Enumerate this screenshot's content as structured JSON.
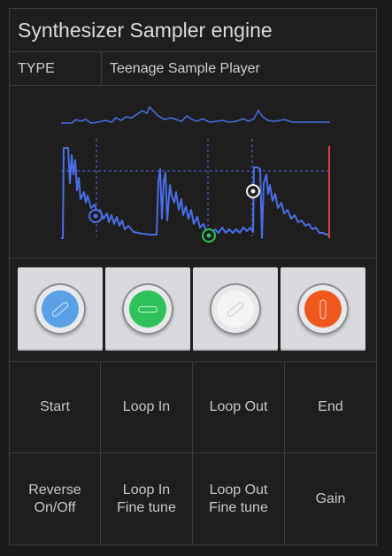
{
  "title": "Synthesizer Sampler engine",
  "type_row": {
    "label": "TYPE",
    "value": "Teenage Sample Player"
  },
  "knobs": [
    {
      "name": "blue",
      "color": "#5aa0e6"
    },
    {
      "name": "green",
      "color": "#2ec35a"
    },
    {
      "name": "white",
      "color": "#f4f4f4"
    },
    {
      "name": "orange",
      "color": "#f0571d"
    }
  ],
  "params": [
    [
      "Start",
      "Loop In",
      "Loop Out",
      "End"
    ],
    [
      "Reverse\nOn/Off",
      "Loop In\nFine tune",
      "Loop Out\nFine tune",
      "Gain"
    ]
  ],
  "colors": {
    "wave": "#4a6ee8",
    "end_marker": "#e23b4a",
    "loop_marker": "#2ec35a"
  }
}
